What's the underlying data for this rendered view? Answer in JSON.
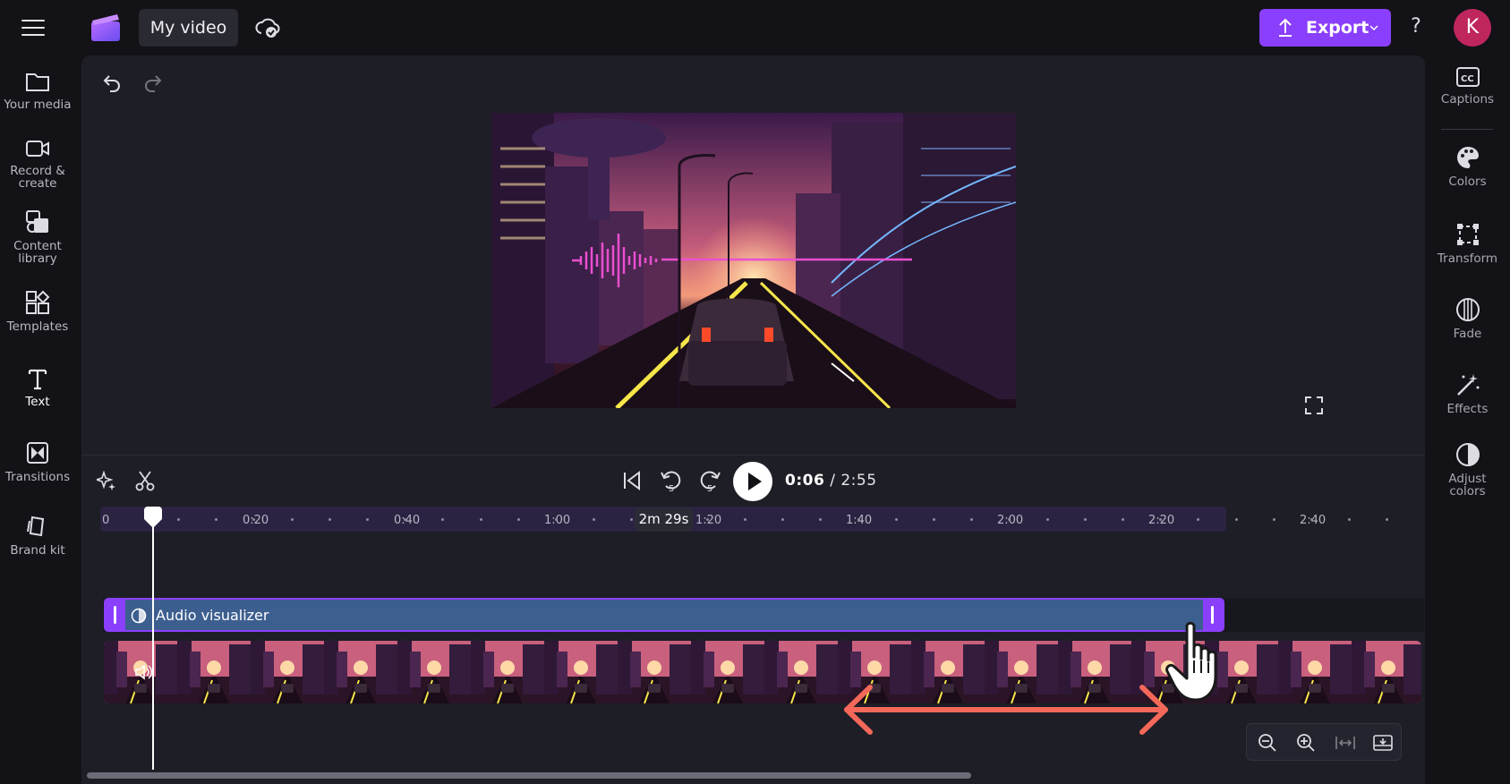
{
  "header": {
    "project_title": "My video",
    "export_label": "Export",
    "help_label": "?",
    "avatar_initial": "K"
  },
  "left_sidebar": {
    "items": [
      {
        "label_l1": "Your media",
        "label_l2": "",
        "icon": "folder-icon"
      },
      {
        "label_l1": "Record &",
        "label_l2": "create",
        "icon": "camera-icon"
      },
      {
        "label_l1": "Content",
        "label_l2": "library",
        "icon": "library-icon"
      },
      {
        "label_l1": "Templates",
        "label_l2": "",
        "icon": "templates-icon"
      },
      {
        "label_l1": "Text",
        "label_l2": "",
        "icon": "text-icon"
      },
      {
        "label_l1": "Transitions",
        "label_l2": "",
        "icon": "transitions-icon"
      },
      {
        "label_l1": "Brand kit",
        "label_l2": "",
        "icon": "brand-kit-icon"
      }
    ]
  },
  "right_sidebar": {
    "items": [
      {
        "label_l1": "Captions",
        "label_l2": "",
        "icon": "captions-icon"
      },
      {
        "label_l1": "Colors",
        "label_l2": "",
        "icon": "palette-icon"
      },
      {
        "label_l1": "Transform",
        "label_l2": "",
        "icon": "transform-icon"
      },
      {
        "label_l1": "Fade",
        "label_l2": "",
        "icon": "fade-icon"
      },
      {
        "label_l1": "Effects",
        "label_l2": "",
        "icon": "magic-wand-icon"
      },
      {
        "label_l1": "Adjust",
        "label_l2": "colors",
        "icon": "adjust-colors-icon"
      }
    ]
  },
  "playback": {
    "current_time": "0:06",
    "separator": "/",
    "total_time": "2:55"
  },
  "ruler": {
    "ticks": [
      "0",
      "0:20",
      "0:40",
      "1:00",
      "1:20",
      "1:40",
      "2:00",
      "2:20",
      "2:40"
    ],
    "tooltip": "2m 29s"
  },
  "tracks": {
    "audio_clip_label": "Audio visualizer"
  },
  "colors": {
    "accent": "#8a3ffc",
    "audio_clip": "#3d5f90",
    "avatar": "#c0265e",
    "annotation_arrow": "#f4685a"
  }
}
